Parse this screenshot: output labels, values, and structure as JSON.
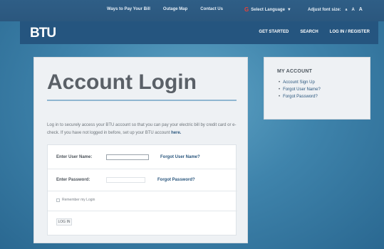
{
  "utility_nav": {
    "items": [
      "Ways to Pay Your Bill",
      "Outage Map",
      "Contact Us"
    ]
  },
  "language": {
    "icon": "google-g-icon",
    "label": "Select Language",
    "caret": "▼"
  },
  "font_size": {
    "label": "Adjust font size:",
    "small": "a",
    "medium": "A",
    "large": "A"
  },
  "header": {
    "logo": "BTU",
    "nav": [
      "GET STARTED",
      "SEARCH",
      "LOG IN / REGISTER"
    ]
  },
  "login": {
    "title": "Account Login",
    "intro_text": "Log in to securely access your BTU account so that you can pay your electric bill by credit card or e-check. If you have not logged in before, set up your BTU account ",
    "intro_link": "here.",
    "username_label": "Enter User Name:",
    "username_value": "",
    "forgot_username": "Forgot User Name?",
    "password_label": "Enter Password:",
    "password_value": "",
    "forgot_password": "Forgot Password?",
    "remember_label": "Remember my Login",
    "remember_checked": false,
    "submit_label": "LOG IN"
  },
  "sidebar": {
    "title": "MY ACCOUNT",
    "links": [
      "Account Sign Up",
      "Forgot User Name?",
      "Forgot Password?"
    ]
  },
  "colors": {
    "background": "#3f84ac",
    "header": "#25557f",
    "link": "#2b577e",
    "card": "#eef1f4"
  }
}
